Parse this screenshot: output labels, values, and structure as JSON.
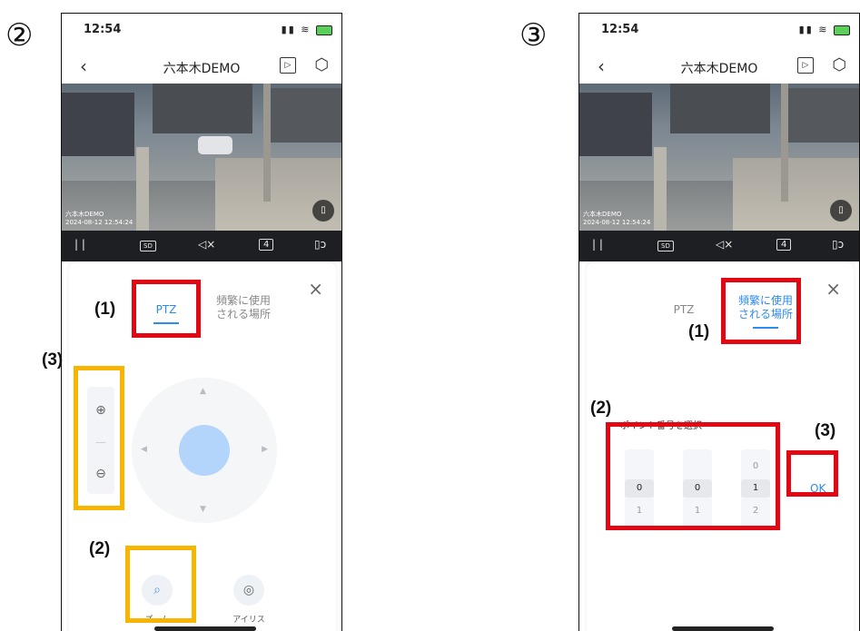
{
  "step_markers": [
    "②",
    "③"
  ],
  "phone": {
    "time": "12:54",
    "title": "六本木DEMO",
    "tabs": {
      "ptz": "PTZ",
      "frequent": "頻繁に使用\nされる場所"
    },
    "overlay_timestamp": "六本木DEMO\n2024-08-12 12:54:24",
    "video_controls": {
      "pause": "| |",
      "sd": "SD",
      "mute": "◁×",
      "layout": "4",
      "rotate": "▯ↄ"
    }
  },
  "left_panel": {
    "features": [
      {
        "label": "ズーム",
        "icon": "search-icon"
      },
      {
        "label": "アイリス",
        "icon": "iris-icon"
      }
    ],
    "annotations": {
      "ptz_tab": "(1)",
      "zoom_button": "(2)",
      "zoom_controls": "(3)"
    }
  },
  "right_panel": {
    "point_label": "ポイント番号を選択",
    "wheels": [
      {
        "prev": "",
        "selected": "0",
        "next": "1"
      },
      {
        "prev": "",
        "selected": "0",
        "next": "1"
      },
      {
        "prev": "0",
        "selected": "1",
        "next": "2"
      }
    ],
    "ok": "OK",
    "annotations": {
      "frequent_tab": "(1)",
      "point_select": "(2)",
      "ok_button": "(3)"
    }
  },
  "colors": {
    "highlight_red": "#e30613",
    "highlight_yellow": "#f7b500",
    "accent_blue": "#2d8cf0"
  }
}
